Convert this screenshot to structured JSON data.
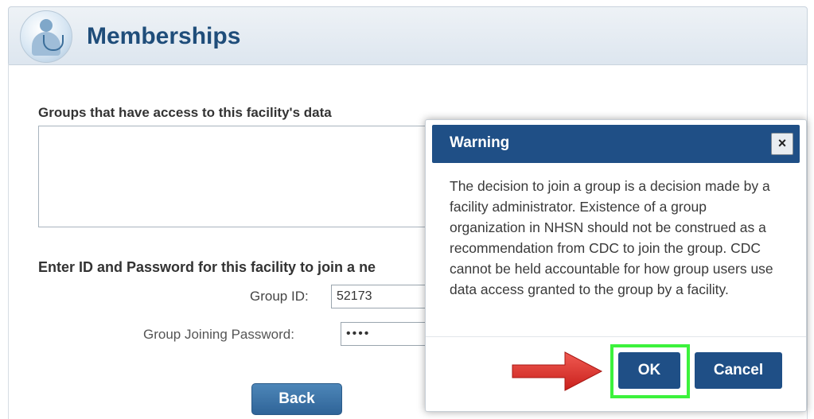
{
  "header": {
    "title": "Memberships"
  },
  "form": {
    "groups_label": "Groups that have access to this facility's data",
    "join_label": "Enter ID and Password for this facility to join a ne",
    "group_id_label": "Group ID:",
    "group_id_value": "52173",
    "group_password_label": "Group Joining Password:",
    "group_password_value": "••••",
    "back_label": "Back"
  },
  "dialog": {
    "title": "Warning",
    "close_glyph": "×",
    "message": "The decision to join a group is a decision made by a facility administrator. Existence of a group organization in NHSN should not be construed as a recommendation from CDC to join the group. CDC cannot be held accountable for how group users use data access granted to the group by a facility.",
    "ok_label": "OK",
    "cancel_label": "Cancel"
  },
  "colors": {
    "dialog_header": "#1f4f86",
    "highlight": "#3cf23c",
    "arrow": "#e8322e"
  },
  "icons": {
    "logo": "medical-staff-icon",
    "close": "close-icon",
    "pointer": "red-arrow-icon"
  }
}
